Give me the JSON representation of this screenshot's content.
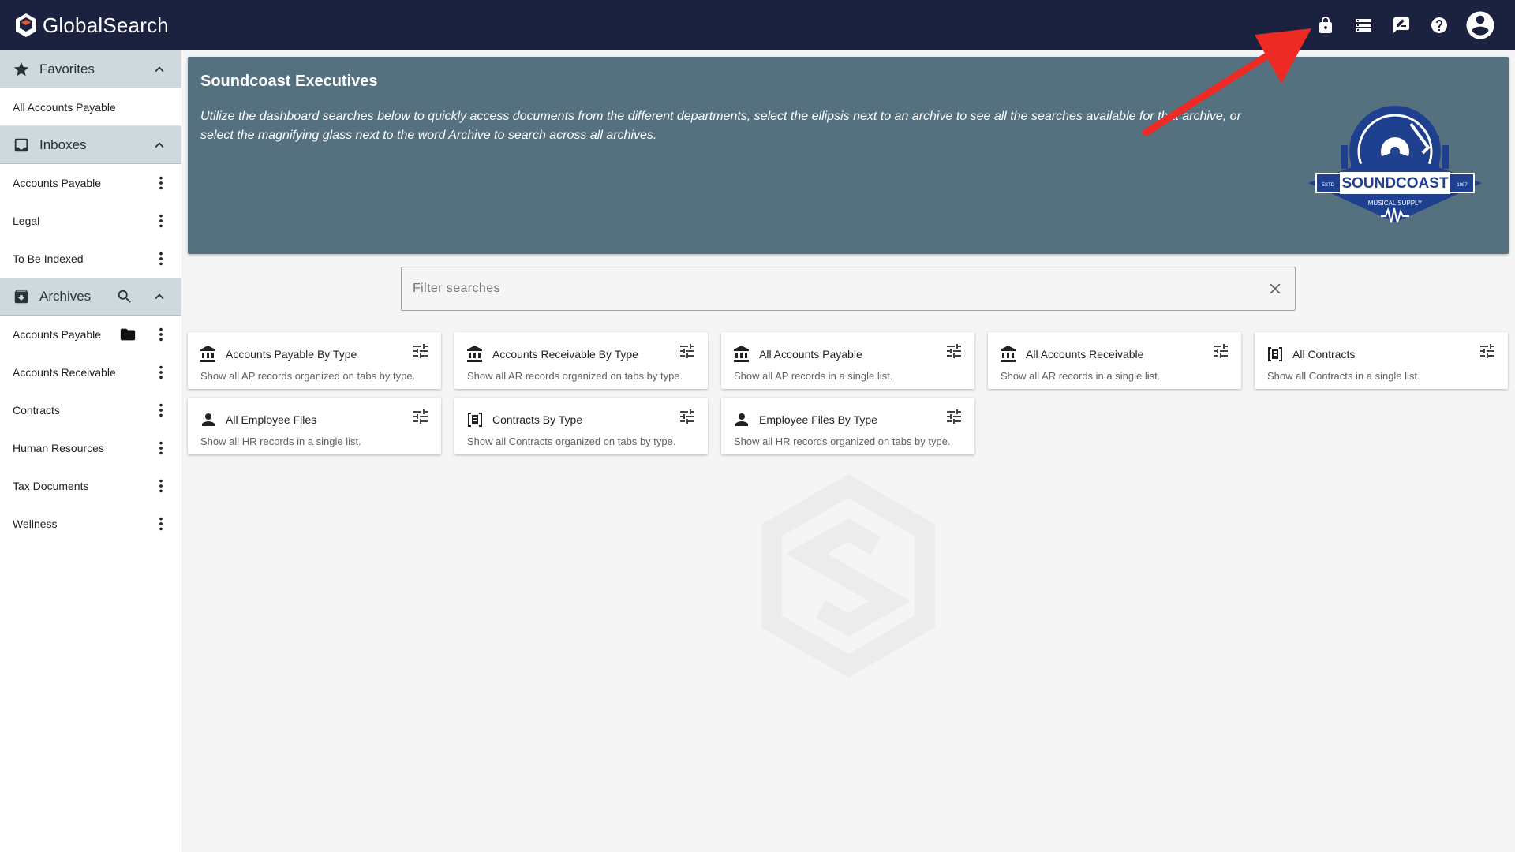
{
  "app": {
    "name": "GlobalSearch"
  },
  "header": {
    "actions": [
      {
        "icon": "lock-icon"
      },
      {
        "icon": "storage-icon"
      },
      {
        "icon": "feedback-icon"
      },
      {
        "icon": "help-icon"
      },
      {
        "icon": "account-circle-icon"
      }
    ]
  },
  "sidebar": {
    "favorites": {
      "title": "Favorites",
      "items": [
        {
          "label": "All Accounts Payable"
        }
      ]
    },
    "inboxes": {
      "title": "Inboxes",
      "items": [
        {
          "label": "Accounts Payable"
        },
        {
          "label": "Legal"
        },
        {
          "label": "To Be Indexed"
        }
      ]
    },
    "archives": {
      "title": "Archives",
      "items": [
        {
          "label": "Accounts Payable"
        },
        {
          "label": "Accounts Receivable"
        },
        {
          "label": "Contracts"
        },
        {
          "label": "Human Resources"
        },
        {
          "label": "Tax Documents"
        },
        {
          "label": "Wellness"
        }
      ]
    }
  },
  "banner": {
    "title": "Soundcoast Executives",
    "text": "Utilize the dashboard searches below to quickly access documents from the different departments, select the ellipsis next to an archive to see all the searches available for that archive, or select the magnifying glass next to the word Archive to search across all archives.",
    "logo": {
      "main": "SOUNDCOAST",
      "sub": "MUSICAL SUPPLY",
      "left": "ESTD",
      "right": "1987"
    }
  },
  "filter": {
    "placeholder": "Filter searches",
    "value": ""
  },
  "cards": [
    {
      "icon": "bank-icon",
      "title": "Accounts Payable By Type",
      "desc": "Show all AP records organized on tabs by type."
    },
    {
      "icon": "bank-icon",
      "title": "Accounts Receivable By Type",
      "desc": "Show all AR records organized on tabs by type."
    },
    {
      "icon": "bank-icon",
      "title": "All Accounts Payable",
      "desc": "Show all AP records in a single list."
    },
    {
      "icon": "bank-icon",
      "title": "All Accounts Receivable",
      "desc": "Show all AR records in a single list."
    },
    {
      "icon": "contract-icon",
      "title": "All Contracts",
      "desc": "Show all Contracts in a single list."
    },
    {
      "icon": "person-icon",
      "title": "All Employee Files",
      "desc": "Show all HR records in a single list."
    },
    {
      "icon": "contract-icon",
      "title": "Contracts By Type",
      "desc": "Show all Contracts organized on tabs by type."
    },
    {
      "icon": "person-icon",
      "title": "Employee Files By Type",
      "desc": "Show all HR records organized on tabs by type."
    }
  ]
}
